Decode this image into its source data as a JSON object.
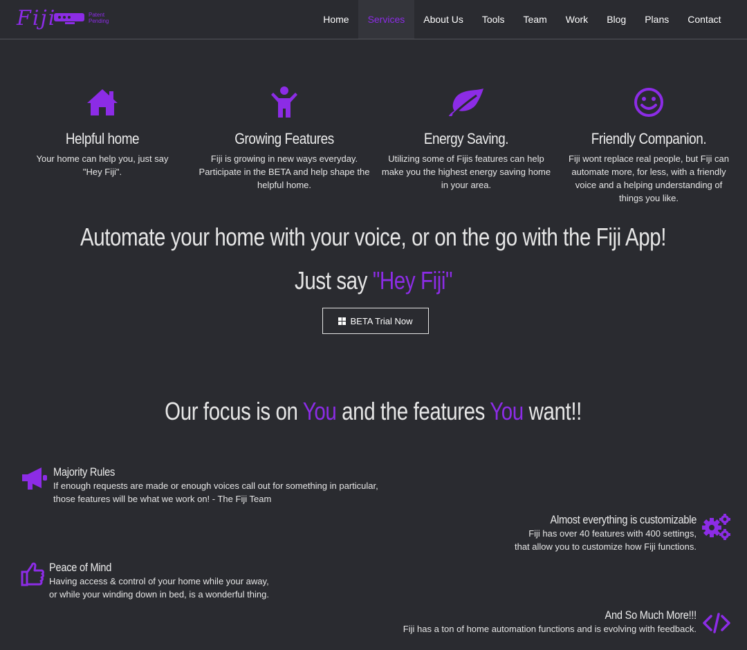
{
  "brand": {
    "logo_text": "Fiji",
    "logo_sub": "Patent Pending",
    "accent_color": "#8c2ce6",
    "background_color": "#2a2b30"
  },
  "nav": {
    "items": [
      "Home",
      "Services",
      "About Us",
      "Tools",
      "Team",
      "Work",
      "Blog",
      "Plans",
      "Contact"
    ],
    "active": "Services"
  },
  "features": [
    {
      "icon": "home-icon",
      "title": "Helpful home",
      "text": "Your home can help you, just say \"Hey Fiji\"."
    },
    {
      "icon": "person-icon",
      "title": "Growing Features",
      "text": "Fiji is growing in new ways everyday. Participate in the BETA and help shape the helpful home."
    },
    {
      "icon": "leaf-icon",
      "title": "Energy Saving.",
      "text": "Utilizing some of Fijis features can help make you the highest energy saving home in your area."
    },
    {
      "icon": "smile-icon",
      "title": "Friendly Companion.",
      "text": "Fiji wont replace real people, but Fiji can automate more, for less, with a friendly voice and a helping understanding of things you like."
    }
  ],
  "hero": {
    "headline": "Automate your home with your voice, or on the go with the Fiji App!",
    "say_prefix": "Just say ",
    "say_phrase": "\"Hey Fiji\"",
    "cta_label": "BETA Trial Now",
    "cta_icon": "windows-icon"
  },
  "focus": {
    "part1": "Our focus is on ",
    "you1": "You",
    "part2": " and the features ",
    "you2": "You",
    "part3": " want!!",
    "items": [
      {
        "icon": "megaphone-icon",
        "title": "Majority Rules",
        "lines": [
          "If enough requests are made or enough voices call out for something in particular,",
          "those features will be what we work on! - The Fiji Team"
        ]
      },
      {
        "icon": "gears-icon",
        "title": "Almost everything is customizable",
        "lines": [
          "Fiji has over 40 features with 400 settings,",
          "that allow you to customize how Fiji functions."
        ]
      },
      {
        "icon": "thumbs-up-icon",
        "title": "Peace of Mind",
        "lines": [
          "Having access & control of your home while your away,",
          "or while your winding down in bed, is a wonderful thing."
        ]
      },
      {
        "icon": "code-icon",
        "title": "And So Much More!!!",
        "lines": [
          "Fiji has a ton of home automation functions and is evolving with feedback."
        ]
      }
    ]
  }
}
